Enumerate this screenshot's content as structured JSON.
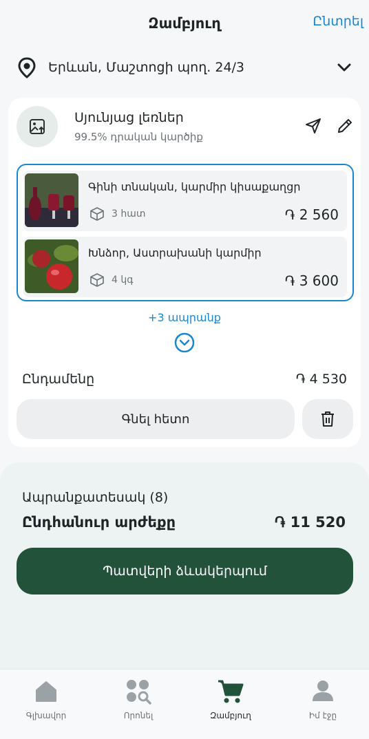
{
  "header": {
    "title": "Զամբյուղ",
    "action": "Ընտրել"
  },
  "address": {
    "text": "Երևան, Մաշտոցի պող. 24/3"
  },
  "store": {
    "name": "Սյունյաց լեռներ",
    "rating": "99.5% դրական կարծիք",
    "items": [
      {
        "name": "Գինի տնական, կարմիր կիսաքաղցր",
        "qty": "3 հատ",
        "price": "֏ 2 560"
      },
      {
        "name": "Խնձոր, Աստրախանի կարմիր",
        "qty": "4 կգ",
        "price": "֏ 3 600"
      }
    ],
    "more": "+3 ապրանք",
    "total_label": "Ընդամենը",
    "total_value": "֏ 4 530",
    "later_label": "Գնել հետո"
  },
  "summary": {
    "count": "Ապրանքատեսակ (8)",
    "total_label": "Ընդհանուր արժեքը",
    "total_value": "֏ 11 520",
    "checkout_label": "Պատվերի ձևակերպում"
  },
  "tabs": [
    {
      "label": "Գլխավոր",
      "icon": "home-icon"
    },
    {
      "label": "Որոնել",
      "icon": "search-icon"
    },
    {
      "label": "Զամբյուղ",
      "icon": "cart-icon"
    },
    {
      "label": "Իմ էջը",
      "icon": "user-icon"
    }
  ],
  "colors": {
    "accent": "#1a86cf",
    "brand": "#23523b"
  }
}
